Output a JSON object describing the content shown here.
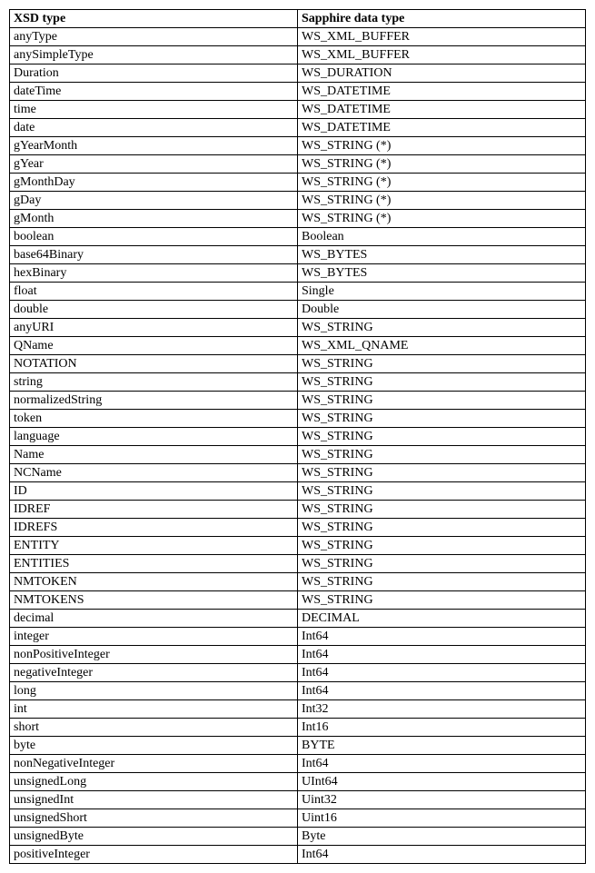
{
  "table": {
    "headers": [
      "XSD type",
      "Sapphire data type"
    ],
    "rows": [
      [
        "anyType",
        "WS_XML_BUFFER"
      ],
      [
        "anySimpleType",
        "WS_XML_BUFFER"
      ],
      [
        "Duration",
        "WS_DURATION"
      ],
      [
        "dateTime",
        "WS_DATETIME"
      ],
      [
        "time",
        "WS_DATETIME"
      ],
      [
        "date",
        "WS_DATETIME"
      ],
      [
        "gYearMonth",
        "WS_STRING (*)"
      ],
      [
        "gYear",
        "WS_STRING (*)"
      ],
      [
        "gMonthDay",
        "WS_STRING (*)"
      ],
      [
        "gDay",
        "WS_STRING (*)"
      ],
      [
        "gMonth",
        "WS_STRING (*)"
      ],
      [
        "boolean",
        "Boolean"
      ],
      [
        "base64Binary",
        "WS_BYTES"
      ],
      [
        "hexBinary",
        " WS_BYTES"
      ],
      [
        "float",
        "Single"
      ],
      [
        "double",
        "Double"
      ],
      [
        "anyURI",
        "WS_STRING"
      ],
      [
        "QName",
        "WS_XML_QNAME"
      ],
      [
        "NOTATION",
        "WS_STRING"
      ],
      [
        "string",
        "WS_STRING"
      ],
      [
        "normalizedString",
        "WS_STRING"
      ],
      [
        "token",
        "WS_STRING"
      ],
      [
        "language",
        "WS_STRING"
      ],
      [
        "Name",
        "WS_STRING"
      ],
      [
        "NCName",
        "WS_STRING"
      ],
      [
        "ID",
        "WS_STRING"
      ],
      [
        "IDREF",
        "WS_STRING"
      ],
      [
        "IDREFS",
        "WS_STRING"
      ],
      [
        "ENTITY",
        "WS_STRING"
      ],
      [
        "ENTITIES",
        "WS_STRING"
      ],
      [
        "NMTOKEN",
        "WS_STRING"
      ],
      [
        "NMTOKENS",
        "WS_STRING"
      ],
      [
        "decimal",
        "DECIMAL"
      ],
      [
        "integer",
        "Int64"
      ],
      [
        "nonPositiveInteger",
        "Int64"
      ],
      [
        "negativeInteger",
        "Int64"
      ],
      [
        "long",
        "Int64"
      ],
      [
        "int",
        "Int32"
      ],
      [
        "short",
        "Int16"
      ],
      [
        "byte",
        "BYTE"
      ],
      [
        "nonNegativeInteger",
        "Int64"
      ],
      [
        "unsignedLong",
        "UInt64"
      ],
      [
        "unsignedInt",
        "Uint32"
      ],
      [
        "unsignedShort",
        "Uint16"
      ],
      [
        "unsignedByte",
        "Byte"
      ],
      [
        "positiveInteger",
        "Int64"
      ]
    ]
  }
}
